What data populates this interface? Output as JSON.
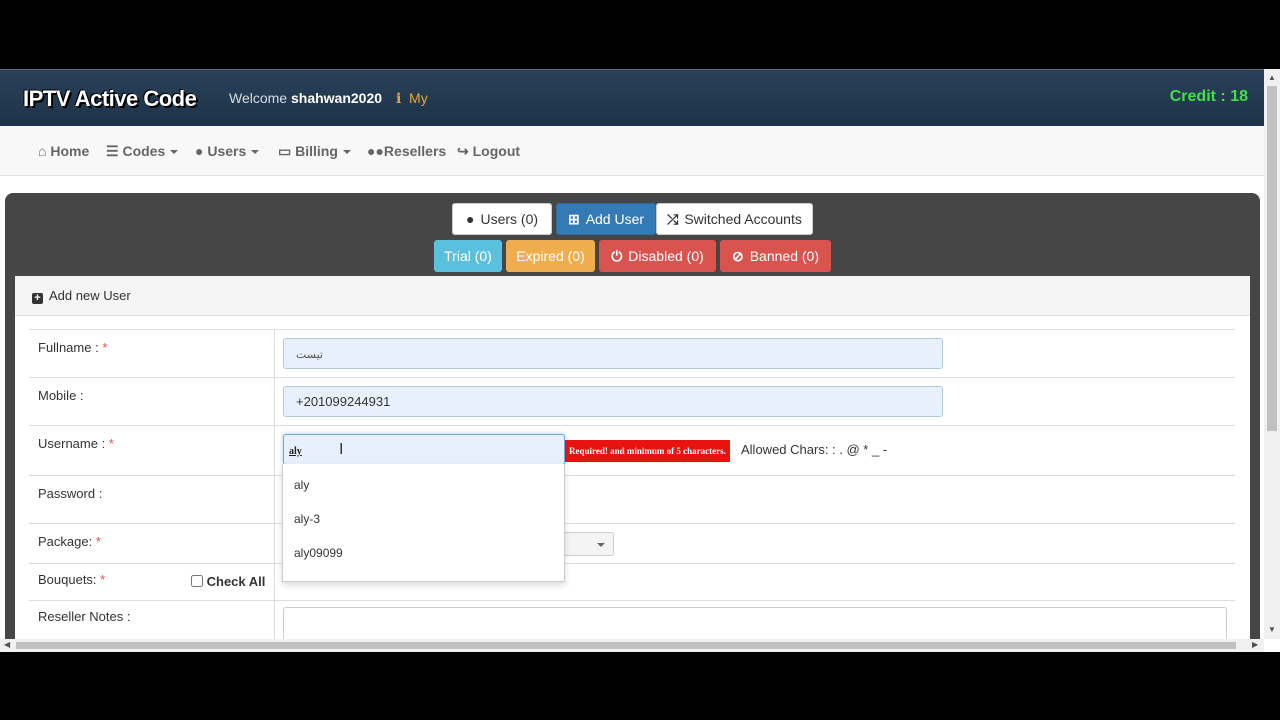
{
  "header": {
    "logo_text": "IPTV Active Code",
    "welcome_prefix": "Welcome",
    "username": "shahwan2020",
    "info_icon": "i",
    "info_link": "My",
    "credit_label": "Credit :",
    "credit_value": "18"
  },
  "nav": {
    "items": [
      {
        "icon": "home-icon",
        "label": "Home"
      },
      {
        "icon": "list-icon",
        "label": "Codes"
      },
      {
        "icon": "user-icon",
        "label": "Users"
      },
      {
        "icon": "billing-icon",
        "label": "Billing"
      },
      {
        "icon": "users-icon",
        "label": "Resellers"
      },
      {
        "icon": "logout-icon",
        "label": "Logout"
      }
    ]
  },
  "toolbar": {
    "users": "Users (0)",
    "add_user": "Add User",
    "switched": "Switched Accounts",
    "trial": "Trial (0)",
    "expired": "Expired (0)",
    "disabled": "Disabled (0)",
    "banned": "Banned (0)"
  },
  "colors": {
    "header_bg": "#1e3349",
    "credit": "#45e047",
    "primary": "#337ab7",
    "info": "#5bc0de",
    "warning": "#f0ad4e",
    "danger": "#d9534f",
    "panel_bg": "#464646"
  },
  "form": {
    "title": "Add new User",
    "fullname_label": "Fullname :",
    "fullname_value": "تيست",
    "mobile_label": "Mobile :",
    "mobile_value": "+201099244931",
    "username_label": "Username :",
    "username_value": "aly",
    "username_error": "Required! and minimum of 5 characters.",
    "allowed_chars": "Allowed Chars: : . @ * _ -",
    "password_label": "Password :",
    "package_label": "Package:",
    "bouquets_label": "Bouquets:",
    "check_all": "Check All",
    "notes_label": "Reseller Notes :",
    "required_mark": "*"
  },
  "autocomplete": {
    "items": [
      "aly",
      "aly-3",
      "aly09099"
    ]
  }
}
